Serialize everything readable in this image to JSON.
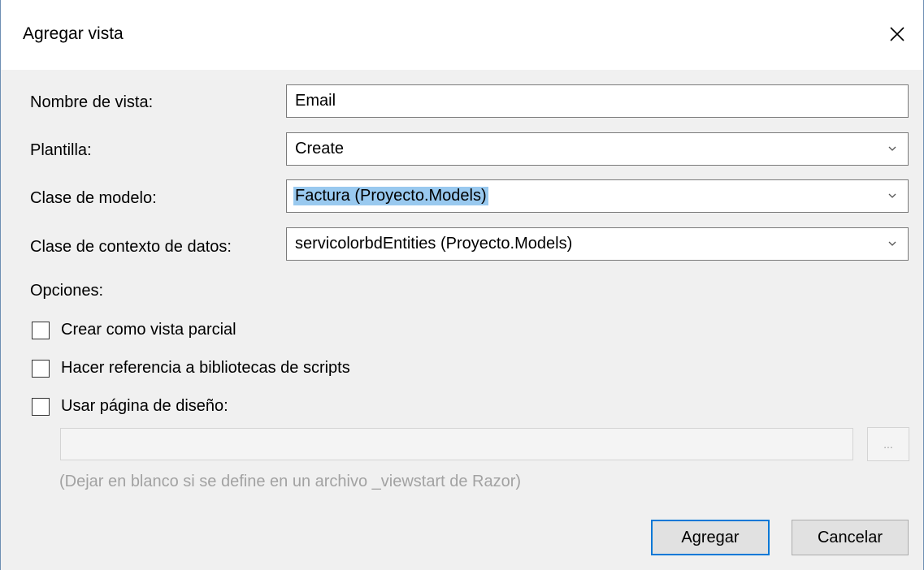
{
  "dialog": {
    "title": "Agregar vista",
    "close_icon": "close-icon"
  },
  "form": {
    "view_name_label": "Nombre de vista:",
    "view_name_value": "Email",
    "template_label": "Plantilla:",
    "template_value": "Create",
    "model_class_label": "Clase de modelo:",
    "model_class_value": "Factura (Proyecto.Models)",
    "data_context_label": "Clase de contexto de datos:",
    "data_context_value": "servicolorbdEntities (Proyecto.Models)"
  },
  "options": {
    "heading": "Opciones:",
    "partial_view_label": "Crear como vista parcial",
    "partial_view_checked": false,
    "script_libraries_label": "Hacer referencia a bibliotecas de scripts",
    "script_libraries_checked": false,
    "layout_page_label": "Usar página de diseño:",
    "layout_page_checked": false,
    "layout_page_value": "",
    "browse_label": "...",
    "hint": "(Dejar en blanco si se define en un archivo _viewstart de Razor)"
  },
  "buttons": {
    "add_label": "Agregar",
    "cancel_label": "Cancelar"
  },
  "colors": {
    "accent": "#0078d7",
    "selection": "#99c9ef",
    "window_border": "#6e8fb3"
  }
}
